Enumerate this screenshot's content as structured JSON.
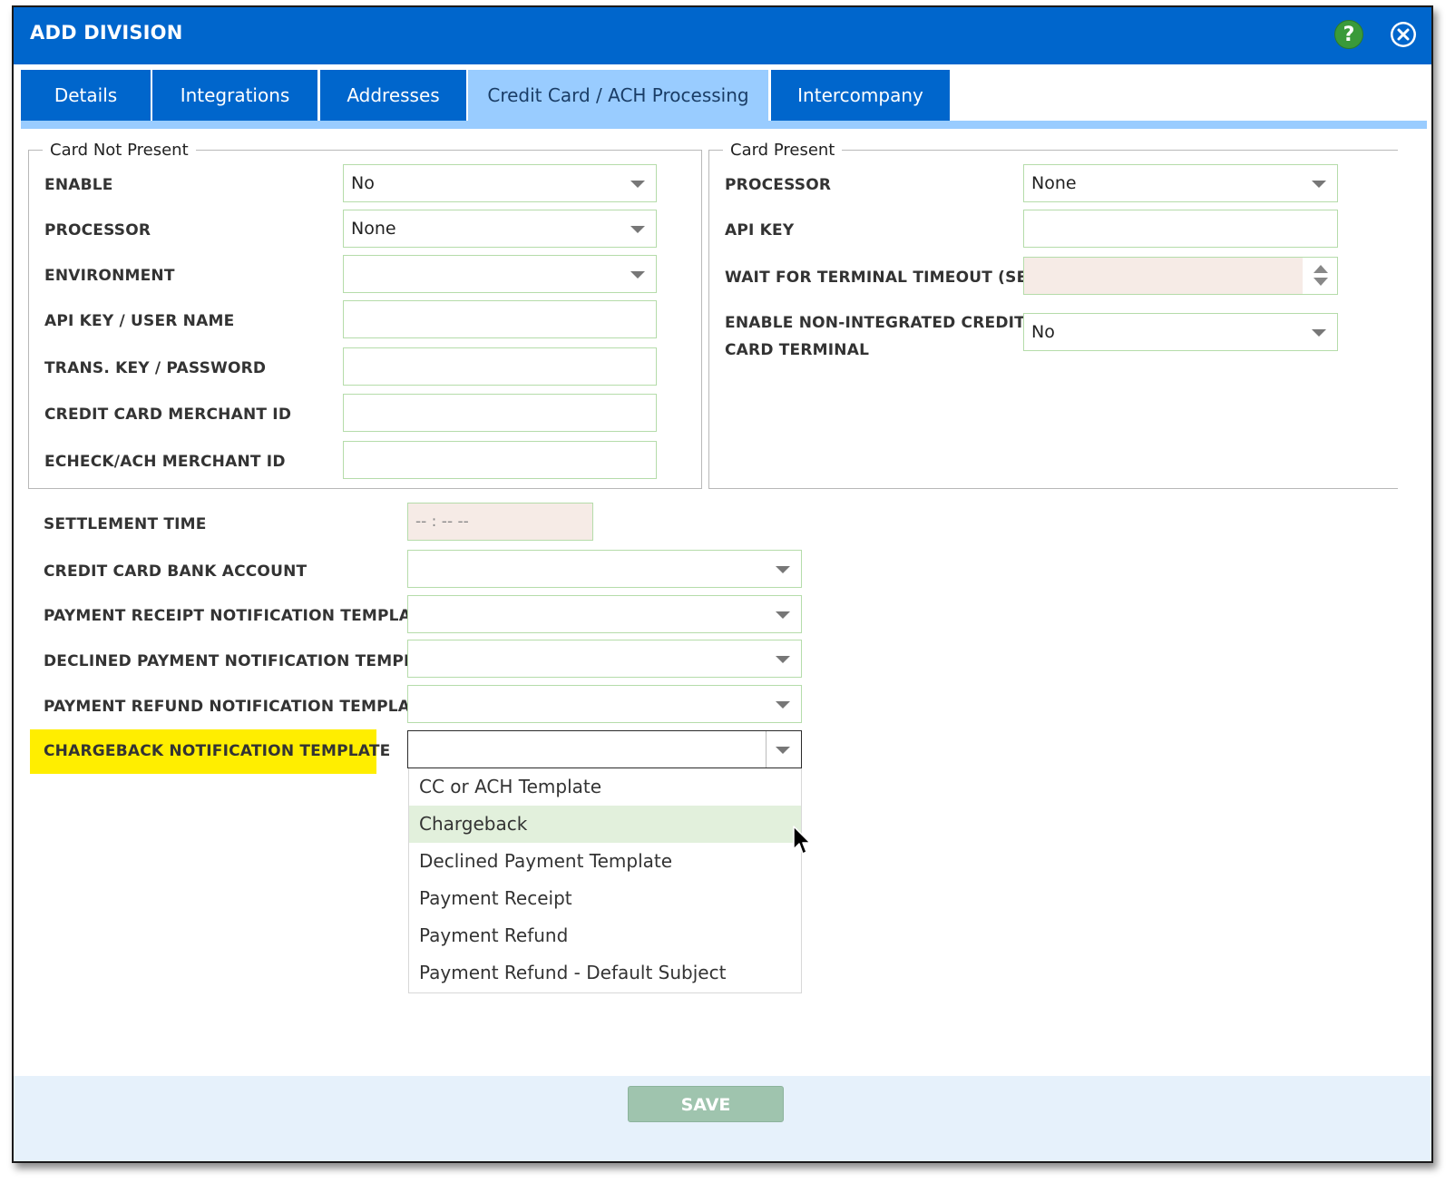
{
  "dialog": {
    "title": "ADD DIVISION",
    "help_symbol": "?"
  },
  "tabs": [
    {
      "label": "Details",
      "active": false
    },
    {
      "label": "Integrations",
      "active": false
    },
    {
      "label": "Addresses",
      "active": false
    },
    {
      "label": "Credit Card / ACH Processing",
      "active": true
    },
    {
      "label": "Intercompany",
      "active": false
    }
  ],
  "card_not_present": {
    "legend": "Card Not Present",
    "enable": {
      "label": "ENABLE",
      "value": "No"
    },
    "processor": {
      "label": "PROCESSOR",
      "value": "None"
    },
    "environment": {
      "label": "ENVIRONMENT",
      "value": ""
    },
    "api_key_user": {
      "label": "API KEY / USER NAME",
      "value": ""
    },
    "trans_key": {
      "label": "TRANS. KEY / PASSWORD",
      "value": ""
    },
    "cc_merchant_id": {
      "label": "CREDIT CARD MERCHANT ID",
      "value": ""
    },
    "echeck_merchant_id": {
      "label": "ECHECK/ACH MERCHANT ID",
      "value": ""
    }
  },
  "card_present": {
    "legend": "Card Present",
    "processor": {
      "label": "PROCESSOR",
      "value": "None"
    },
    "api_key": {
      "label": "API KEY",
      "value": ""
    },
    "timeout": {
      "label": "WAIT FOR TERMINAL TIMEOUT (SEC)",
      "value": ""
    },
    "non_integrated": {
      "label_line1": "ENABLE NON-INTEGRATED CREDIT",
      "label_line2": "CARD TERMINAL",
      "value": "No"
    }
  },
  "settings": {
    "settlement_time": {
      "label": "SETTLEMENT TIME",
      "placeholder": "-- : --   --"
    },
    "bank_account": {
      "label": "CREDIT CARD BANK ACCOUNT",
      "value": ""
    },
    "receipt_template": {
      "label": "PAYMENT RECEIPT NOTIFICATION TEMPLATE",
      "value": ""
    },
    "declined_template": {
      "label": "DECLINED PAYMENT NOTIFICATION TEMPLATE",
      "value": ""
    },
    "refund_template": {
      "label": "PAYMENT REFUND NOTIFICATION TEMPLATE",
      "value": ""
    },
    "chargeback_template": {
      "label": "CHARGEBACK NOTIFICATION TEMPLATE",
      "value": ""
    }
  },
  "chargeback_options": [
    "CC or ACH Template",
    "Chargeback",
    "Declined Payment Template",
    "Payment Receipt",
    "Payment Refund",
    "Payment Refund - Default Subject"
  ],
  "hovered_option": "Chargeback",
  "footer": {
    "save_label": "SAVE"
  },
  "colors": {
    "titlebar": "#0066cc",
    "active_tab": "#99ccff",
    "highlight": "#ffee00",
    "field_border": "#b5dcaa",
    "save_button": "#9fc4ae"
  }
}
